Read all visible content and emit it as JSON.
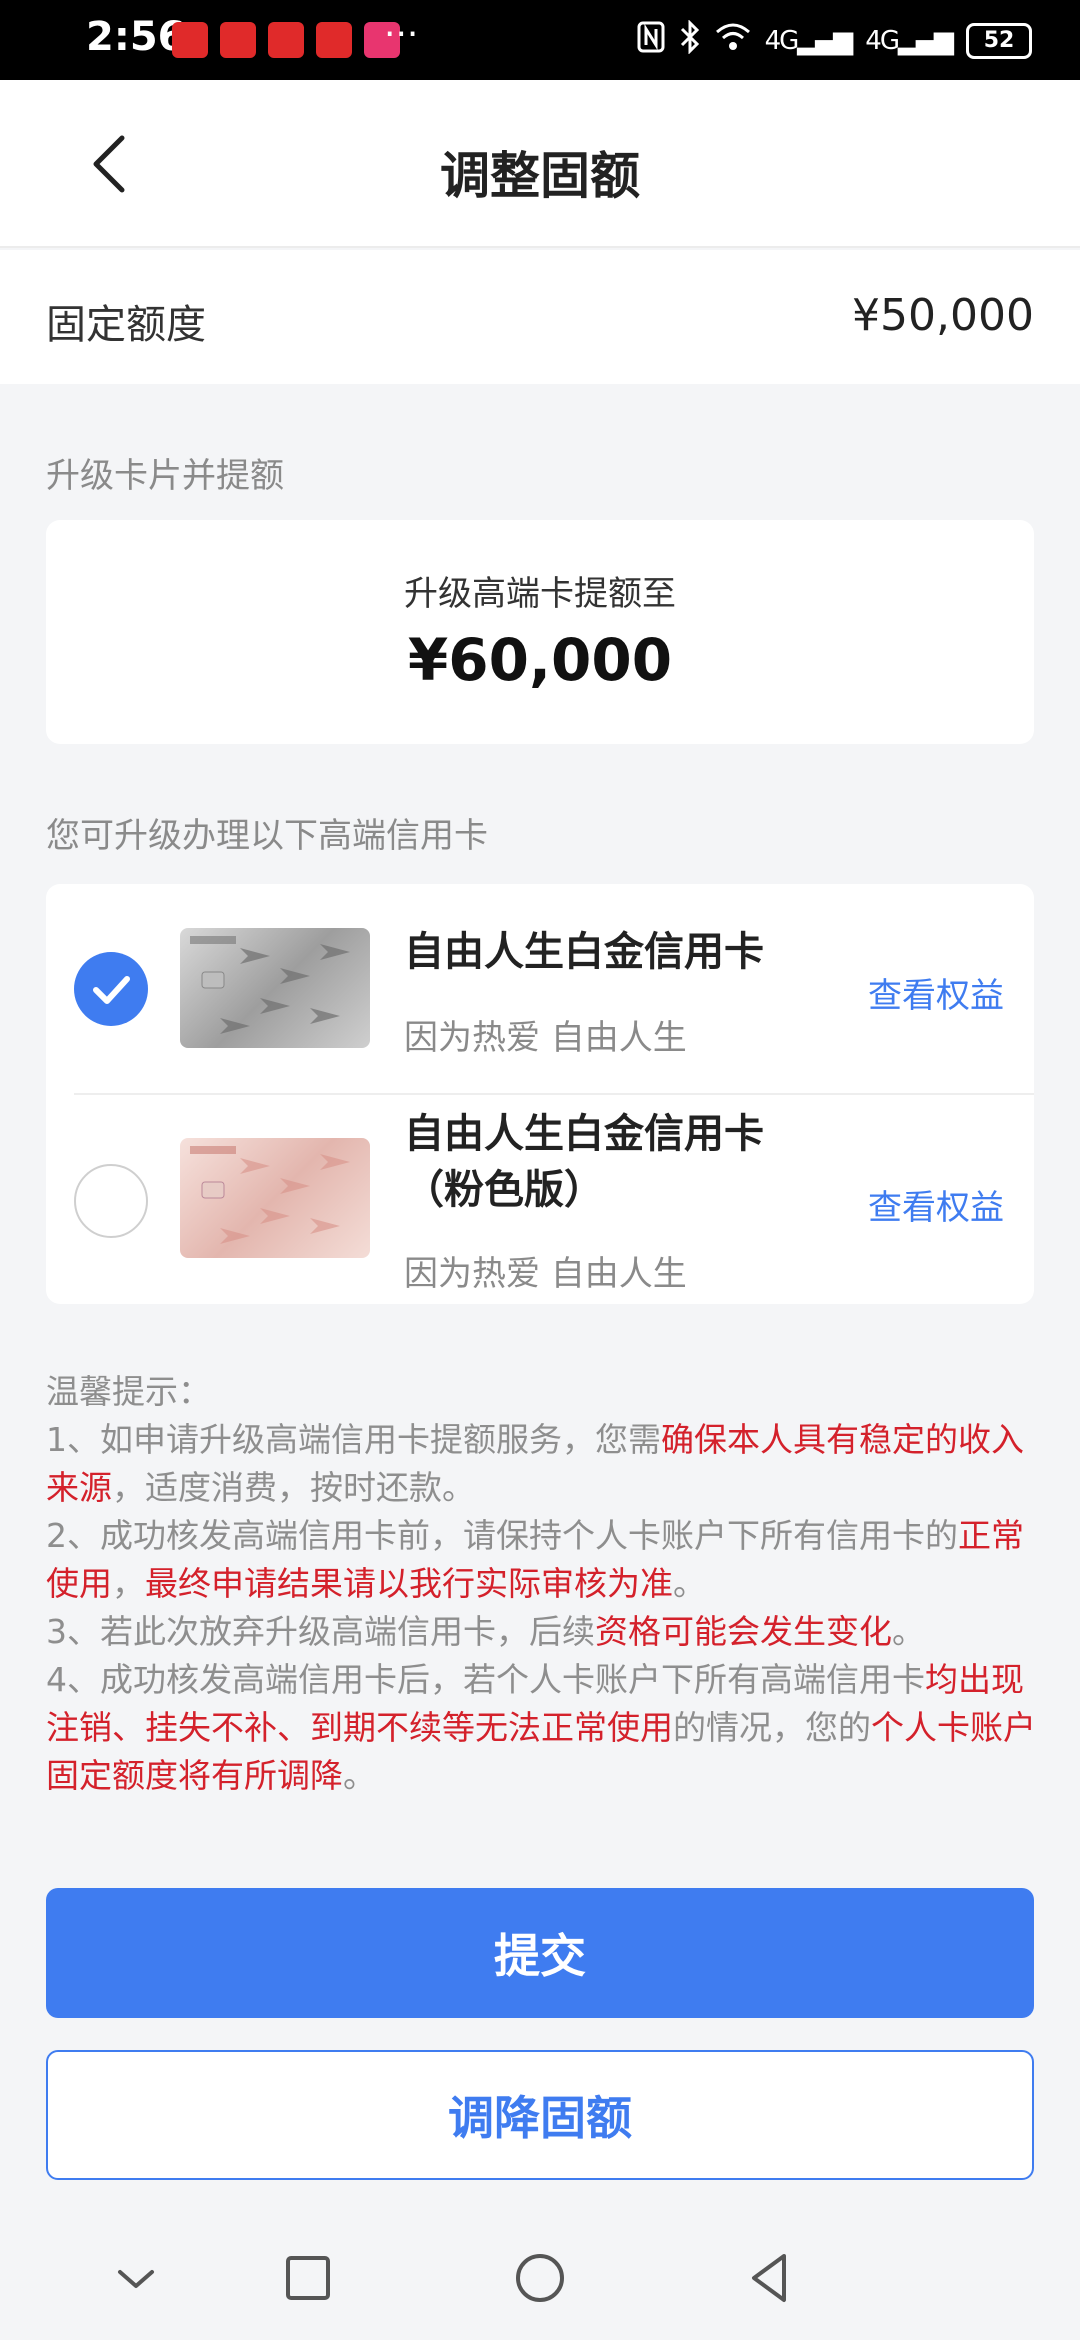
{
  "status_bar": {
    "time": "2:56",
    "more": "···",
    "network_1": "4G",
    "network_2": "4G",
    "battery": "52"
  },
  "header": {
    "title": "调整固额"
  },
  "fixed_amount": {
    "label": "固定额度",
    "value": "¥50,000"
  },
  "upgrade_section": {
    "label": "升级卡片并提额",
    "subtitle": "升级高端卡提额至",
    "amount": "¥60,000"
  },
  "cards_section": {
    "label": "您可升级办理以下高端信用卡",
    "items": [
      {
        "name": "自由人生白金信用卡",
        "description": "因为热爱 自由人生",
        "link": "查看权益",
        "selected": true
      },
      {
        "name_line1": "自由人生白金信用卡",
        "name_line2": "（粉色版）",
        "description": "因为热爱 自由人生",
        "link": "查看权益",
        "selected": false
      }
    ]
  },
  "tips": {
    "title": "温馨提示：",
    "p1_a": "1、如申请升级高端信用卡提额服务，您需",
    "p1_b": "确保本人具有稳定的收入来源",
    "p1_c": "，适度消费，按时还款。",
    "p2_a": "2、成功核发高端信用卡前，请保持个人卡账户下所有信用卡的",
    "p2_b": "正常使用",
    "p2_c": "，",
    "p2_d": "最终申请结果请以我行实际审核为准",
    "p2_e": "。",
    "p3_a": "3、若此次放弃升级高端信用卡，后续",
    "p3_b": "资格可能会发生变化",
    "p3_c": "。",
    "p4_a": "4、成功核发高端信用卡后，若个人卡账户下所有高端信用卡",
    "p4_b": "均出现注销、挂失不补、到期不续等无法正常使用",
    "p4_c": "的情况，您的",
    "p4_d": "个人卡账户固定额度将有所调降",
    "p4_e": "。"
  },
  "buttons": {
    "submit": "提交",
    "reduce": "调降固额"
  },
  "colors": {
    "accent": "#3f7cf0",
    "highlight": "#d4212b",
    "background": "#f4f5f7"
  }
}
